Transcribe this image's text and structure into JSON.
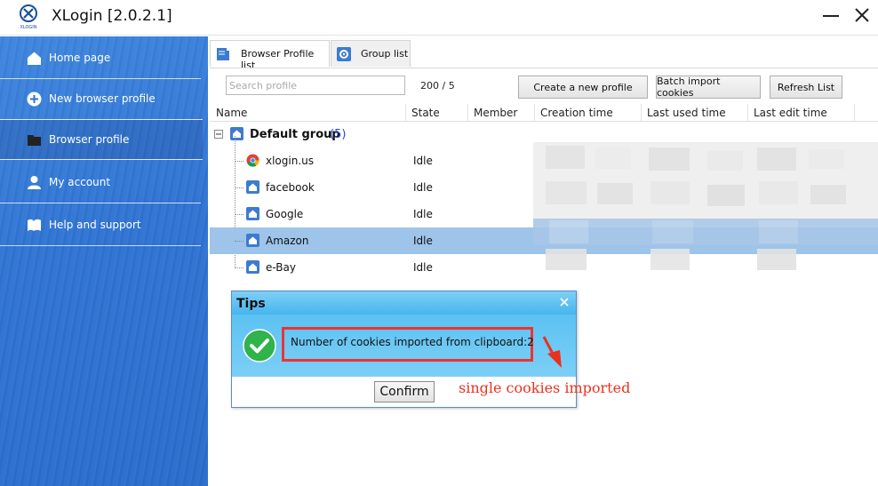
{
  "window": {
    "title": "XLogin [2.0.2.1]",
    "logo_text": "XLOGIN"
  },
  "sidebar": {
    "items": [
      {
        "label": "Home page",
        "icon": "home-icon"
      },
      {
        "label": "New browser profile",
        "icon": "plus-circle-icon"
      },
      {
        "label": "Browser profile",
        "icon": "folder-icon",
        "active": true
      },
      {
        "label": "My account",
        "icon": "user-icon"
      },
      {
        "label": "Help and support",
        "icon": "book-icon"
      }
    ]
  },
  "tabs": [
    {
      "label": "Browser Profile list",
      "active": true
    },
    {
      "label": "Group list",
      "active": false
    }
  ],
  "toolbar": {
    "search_placeholder": "Search profile",
    "count": "200 / 5",
    "create_label": "Create a new profile",
    "batch_label": "Batch import cookies",
    "refresh_label": "Refresh List"
  },
  "table": {
    "columns": [
      "Name",
      "State",
      "Member",
      "Creation time",
      "Last used time",
      "Last edit time"
    ],
    "group": {
      "name": "Default group",
      "count": "(5)"
    },
    "rows": [
      {
        "name": "xlogin.us",
        "state": "Idle",
        "icon": "chrome-icon"
      },
      {
        "name": "facebook",
        "state": "Idle",
        "icon": "home-icon"
      },
      {
        "name": "Google",
        "state": "Idle",
        "icon": "home-icon"
      },
      {
        "name": "Amazon",
        "state": "Idle",
        "icon": "home-icon",
        "selected": true
      },
      {
        "name": "e-Bay",
        "state": "Idle",
        "icon": "home-icon"
      }
    ]
  },
  "dialog": {
    "title": "Tips",
    "message": "Number of cookies imported from clipboard:2",
    "confirm_label": "Confirm"
  },
  "annotation": "single cookies imported",
  "colors": {
    "accent": "#2f74d3",
    "selected_row": "#9ec4ea",
    "annotation": "#e8321f",
    "success": "#2fb34a"
  }
}
